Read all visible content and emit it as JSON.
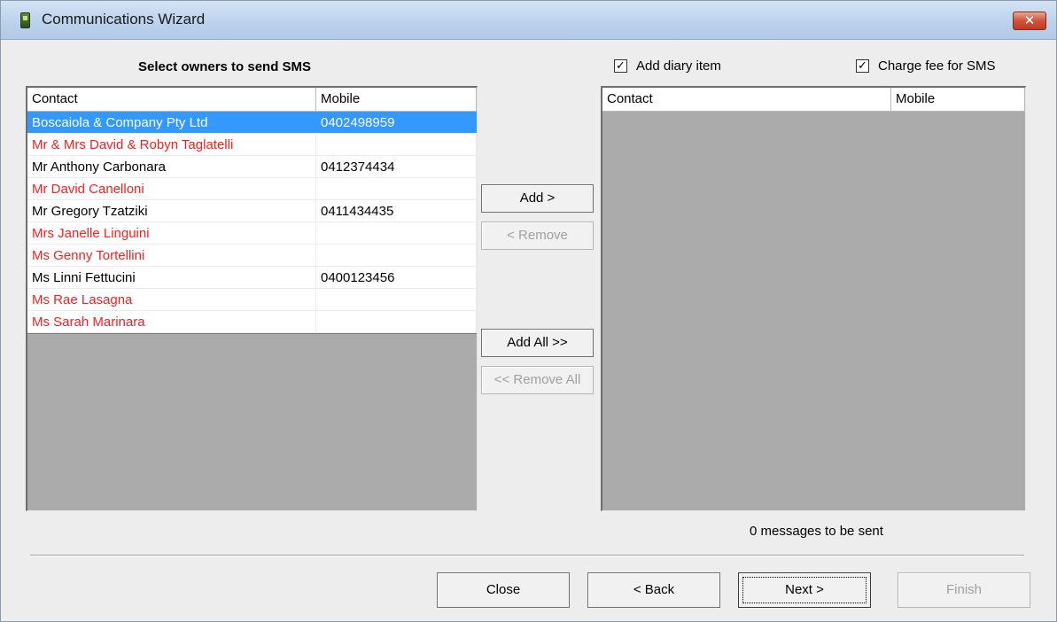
{
  "window": {
    "title": "Communications Wizard",
    "close_glyph": "✕"
  },
  "left_panel": {
    "heading": "Select owners to send SMS",
    "columns": [
      "Contact",
      "Mobile"
    ],
    "rows": [
      {
        "contact": "Boscaiola & Company Pty Ltd",
        "mobile": "0402498959"
      },
      {
        "contact": "Mr & Mrs David & Robyn Taglatelli",
        "mobile": ""
      },
      {
        "contact": "Mr Anthony Carbonara",
        "mobile": "0412374434"
      },
      {
        "contact": "Mr David Canelloni",
        "mobile": ""
      },
      {
        "contact": "Mr Gregory Tzatziki",
        "mobile": "0411434435"
      },
      {
        "contact": "Mrs Janelle Linguini",
        "mobile": ""
      },
      {
        "contact": "Ms Genny Tortellini",
        "mobile": ""
      },
      {
        "contact": "Ms Linni Fettucini",
        "mobile": "0400123456"
      },
      {
        "contact": "Ms Rae Lasagna",
        "mobile": ""
      },
      {
        "contact": "Ms Sarah Marinara",
        "mobile": ""
      }
    ]
  },
  "options": {
    "add_diary_item": {
      "label": "Add diary item",
      "checked": true,
      "glyph": "✓"
    },
    "charge_fee": {
      "label": "Charge fee for SMS",
      "checked": true,
      "glyph": "✓"
    }
  },
  "right_panel": {
    "columns": [
      "Contact",
      "Mobile"
    ],
    "rows": []
  },
  "transfer_buttons": {
    "add": "Add >",
    "remove": "< Remove",
    "add_all": "Add All >>",
    "remove_all": "<< Remove All"
  },
  "status": {
    "message": "0 messages to be sent"
  },
  "footer": {
    "close": "Close",
    "back": "< Back",
    "next": "Next >",
    "finish": "Finish"
  },
  "colors": {
    "selection": "#3399ff",
    "no_mobile_text": "#ff1d1d",
    "list_background": "#ababab"
  }
}
